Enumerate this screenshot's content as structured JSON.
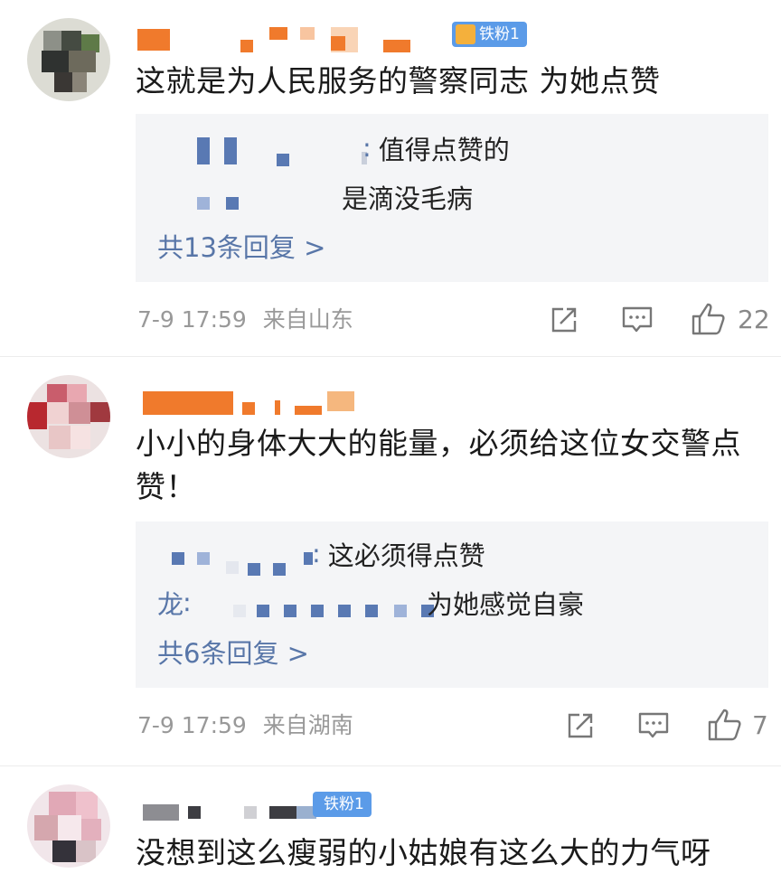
{
  "comments": [
    {
      "badge": "铁粉1",
      "text": "这就是为人民服务的警察同志 为她点赞",
      "replies": [
        {
          "name": "",
          "sep": "∶",
          "text": "值得点赞的"
        },
        {
          "name": "",
          "sep": "",
          "text": "是滴没毛病"
        }
      ],
      "more": "共13条回复 >",
      "time": "7-9 17:59",
      "location": "来自山东",
      "likes": "22"
    },
    {
      "badge": "",
      "text_line1": "小小的身体大大的能量，必须给这位女交警点",
      "text_line2": "赞！",
      "replies": [
        {
          "name": "",
          "sep": "∶",
          "text": "这必须得点赞"
        },
        {
          "name": "龙∶",
          "sep": "",
          "text": "为她感觉自豪"
        }
      ],
      "more": "共6条回复 >",
      "time": "7-9 17:59",
      "location": "来自湖南",
      "likes": "7"
    },
    {
      "badge": "铁粉1",
      "text": "没想到这么瘦弱的小姑娘有这么大的力气呀"
    }
  ],
  "colors": {
    "link": "#5876a8",
    "badge": "#5b9be8",
    "reply_bg": "#f4f5f7",
    "meta": "#999999"
  },
  "icons": [
    "share-icon",
    "comment-icon",
    "like-icon"
  ]
}
